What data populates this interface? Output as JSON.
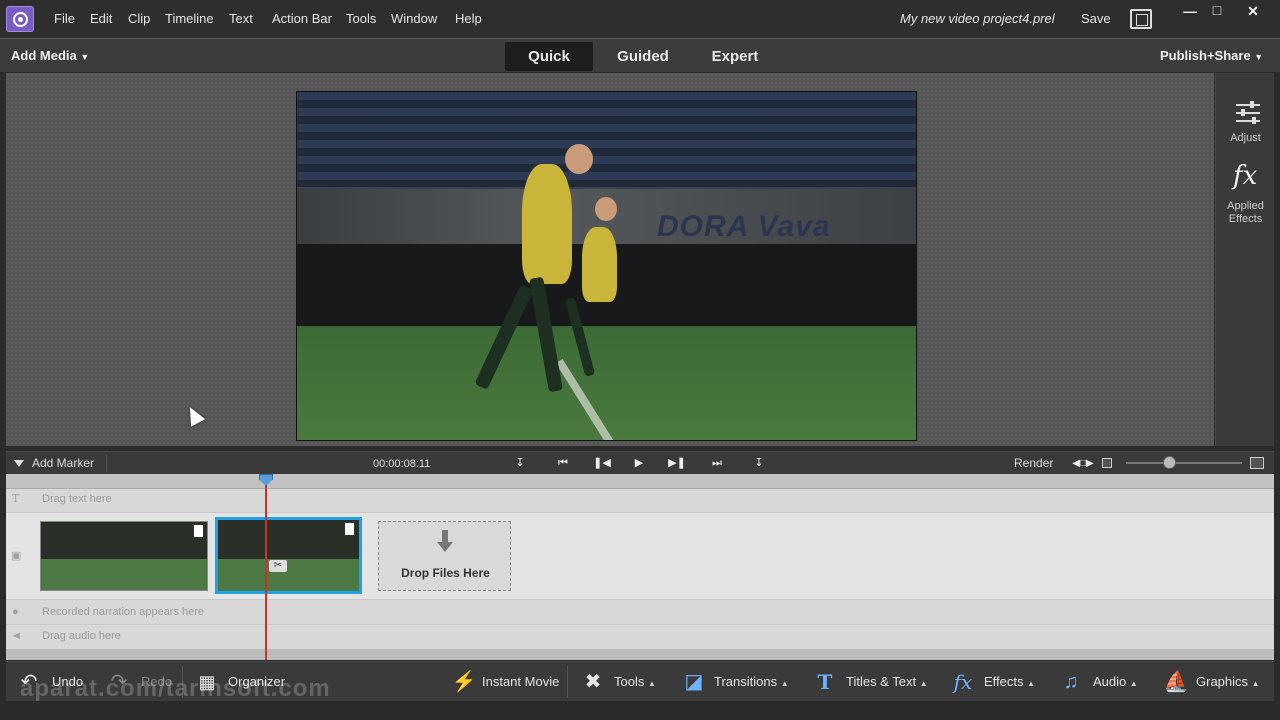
{
  "menubar": {
    "items": [
      "File",
      "Edit",
      "Clip",
      "Timeline",
      "Text",
      "Action Bar",
      "Tools",
      "Window",
      "Help"
    ],
    "project_title": "My new video project4.prel",
    "save_label": "Save"
  },
  "modebar": {
    "add_media": "Add Media",
    "tabs": [
      "Quick",
      "Guided",
      "Expert"
    ],
    "active_tab": "Quick",
    "publish_share": "Publish+Share"
  },
  "preview": {
    "banner_text": "DORA  Vava"
  },
  "right_panel": {
    "adjust_label": "Adjust",
    "effects_label_1": "Applied",
    "effects_label_2": "Effects"
  },
  "timeline_controls": {
    "add_marker": "Add Marker",
    "timecode": "00:00:08:11",
    "render": "Render"
  },
  "timeline": {
    "text_track_hint": "Drag text here",
    "drop_files": "Drop Files Here",
    "narration_hint": "Recorded narration appears here",
    "audio_hint": "Drag audio here"
  },
  "actionbar": {
    "undo": "Undo",
    "redo": "Redo",
    "organizer": "Organizer",
    "instant_movie": "Instant Movie",
    "tools": "Tools",
    "transitions": "Transitions",
    "titles_text": "Titles & Text",
    "effects": "Effects",
    "audio": "Audio",
    "graphics": "Graphics"
  },
  "watermark": "aparat.com/tarinsoft.com",
  "colors": {
    "accent": "#1fa3e8",
    "playhead": "#d0302a",
    "logo": "#7b5bc4"
  }
}
